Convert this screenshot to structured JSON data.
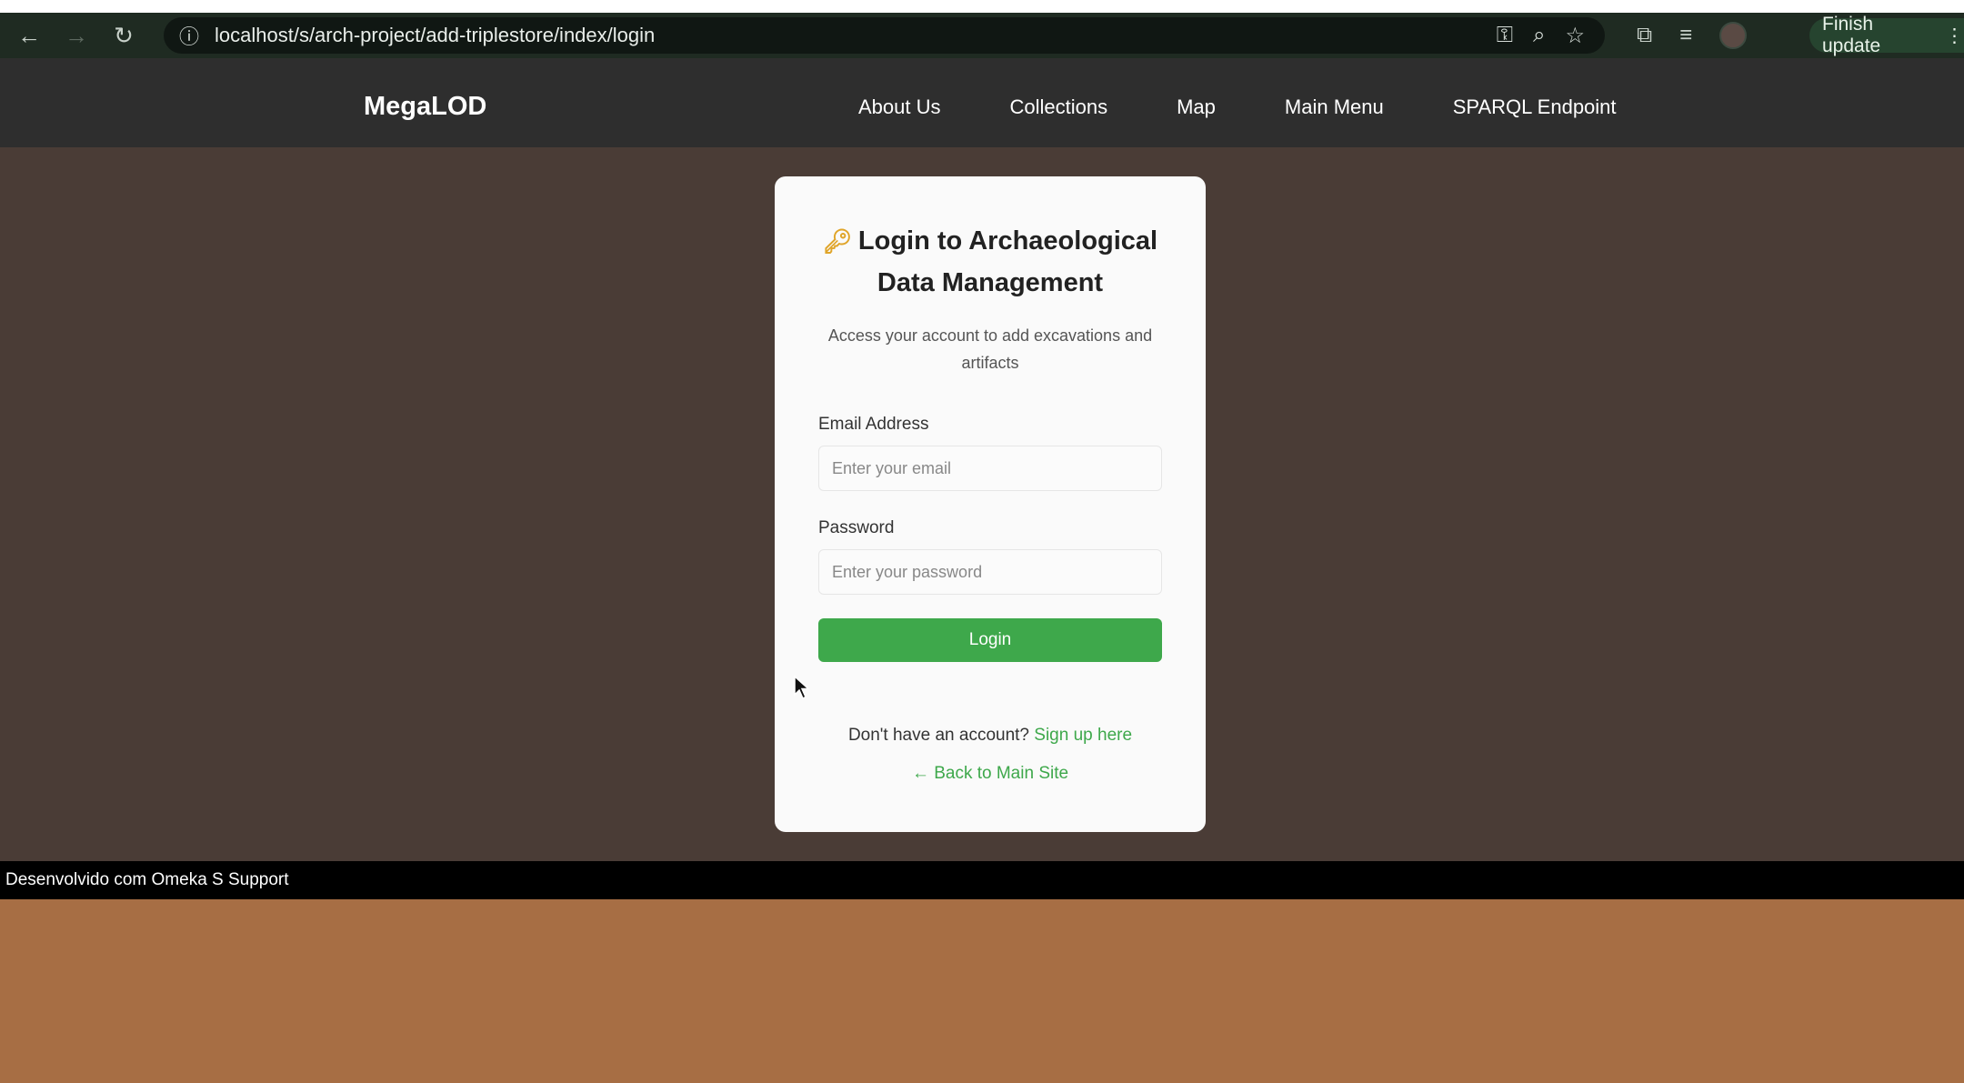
{
  "browser": {
    "url": "localhost/s/arch-project/add-triplestore/index/login",
    "finish_update_label": "Finish update"
  },
  "site": {
    "brand": "MegaLOD",
    "nav": [
      {
        "label": "About Us"
      },
      {
        "label": "Collections"
      },
      {
        "label": "Map"
      },
      {
        "label": "Main Menu"
      },
      {
        "label": "SPARQL Endpoint"
      }
    ]
  },
  "login": {
    "title_line1": "Login to Archaeological",
    "title_line2": "Data Management",
    "subtitle_line1": "Access your account to add excavations and",
    "subtitle_line2": "artifacts",
    "email_label": "Email Address",
    "email_placeholder": "Enter your email",
    "email_value": "",
    "password_label": "Password",
    "password_placeholder": "Enter your password",
    "password_value": "",
    "submit_label": "Login",
    "signup_prompt": "Don't have an account?",
    "signup_link": "Sign up here",
    "back_link": "← Back to Main Site"
  },
  "footer": {
    "text": "Desenvolvido com Omeka S Support"
  },
  "colors": {
    "accent_green": "#3ea84b",
    "nav_bg": "#2e2e2e",
    "content_bg": "#4a3c36",
    "bottom_bg": "#a76e44"
  }
}
